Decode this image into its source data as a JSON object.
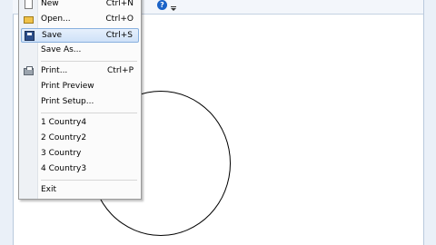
{
  "menu": {
    "items": [
      {
        "label": "New",
        "shortcut": "Ctrl+N",
        "icon": "new-document-icon"
      },
      {
        "label": "Open...",
        "shortcut": "Ctrl+O",
        "icon": "open-folder-icon"
      },
      {
        "label": "Save",
        "shortcut": "Ctrl+S",
        "icon": "save-disk-icon",
        "highlighted": true
      },
      {
        "label": "Save As...",
        "shortcut": ""
      },
      {
        "label": "Print...",
        "shortcut": "Ctrl+P",
        "icon": "printer-icon"
      },
      {
        "label": "Print Preview",
        "shortcut": ""
      },
      {
        "label": "Print Setup...",
        "shortcut": ""
      },
      {
        "label": "1 Country4",
        "shortcut": ""
      },
      {
        "label": "2 Country2",
        "shortcut": ""
      },
      {
        "label": "3 Country",
        "shortcut": ""
      },
      {
        "label": "4 Country3",
        "shortcut": ""
      },
      {
        "label": "Exit",
        "shortcut": ""
      }
    ]
  },
  "toolbar": {
    "help_glyph": "?",
    "icons": [
      "help-icon",
      "toolbar-overflow-icon"
    ]
  },
  "colors": {
    "highlight": "#cfe2f8",
    "highlight_border": "#88b0de",
    "menu_background": "#fbfbfb",
    "help_icon": "#1b63c7"
  }
}
